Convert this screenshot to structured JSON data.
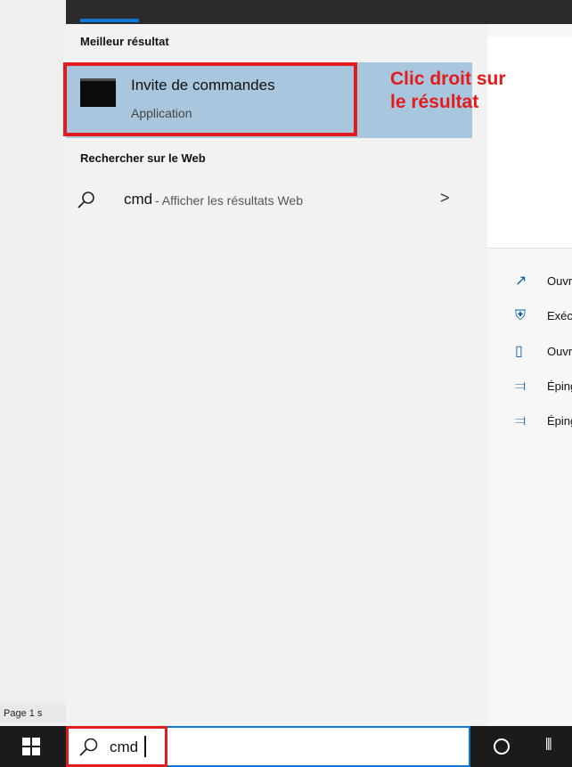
{
  "status_bar": {
    "page_text": "Page 1 s"
  },
  "search_panel": {
    "best_match_heading": "Meilleur résultat",
    "best_match": {
      "title": "Invite de commandes",
      "subtitle": "Application"
    },
    "web_heading": "Rechercher sur le Web",
    "web_result": {
      "query": "cmd",
      "hint": "- Afficher les résultats Web"
    }
  },
  "annotation": {
    "line1": "Clic droit sur",
    "line2": "le résultat"
  },
  "context_actions": [
    {
      "icon": "open-icon",
      "label": "Ouvrir"
    },
    {
      "icon": "admin-shield-icon",
      "label": "Exécuter"
    },
    {
      "icon": "file-location-icon",
      "label": "Ouvrir"
    },
    {
      "icon": "pin-start-icon",
      "label": "Épingler"
    },
    {
      "icon": "pin-taskbar-icon",
      "label": "Épingler"
    }
  ],
  "taskbar": {
    "search_value": "cmd"
  },
  "colors": {
    "accent": "#0a78d7",
    "highlight": "#a8c7de",
    "annotation": "#e21c1c"
  }
}
